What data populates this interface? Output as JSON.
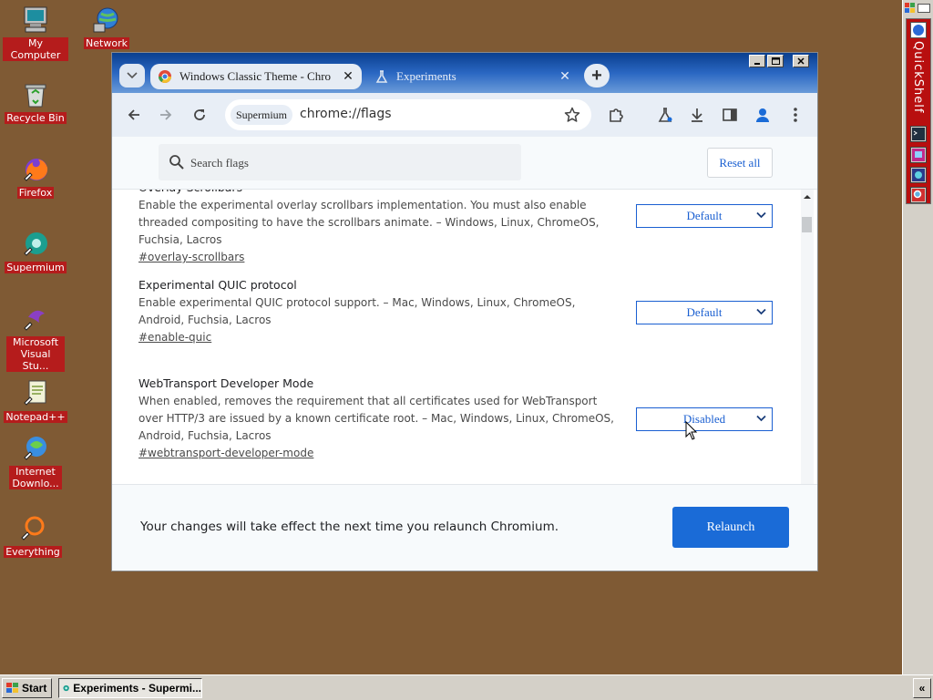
{
  "desktop": {
    "icons": [
      {
        "label": "My Computer",
        "icon": "my-computer-icon"
      },
      {
        "label": "Network",
        "icon": "network-icon"
      },
      {
        "label": "Recycle Bin",
        "icon": "recycle-bin-icon"
      },
      {
        "label": "Firefox",
        "icon": "firefox-icon"
      },
      {
        "label": "Supermium",
        "icon": "supermium-icon"
      },
      {
        "label": "Microsoft Visual Stu...",
        "icon": "visual-studio-icon"
      },
      {
        "label": "Notepad++",
        "icon": "notepad-plus-plus-icon"
      },
      {
        "label": "Internet Downlo...",
        "icon": "internet-download-manager-icon"
      },
      {
        "label": "Everything",
        "icon": "everything-search-icon"
      }
    ],
    "background_color": "#7f5a34"
  },
  "browser": {
    "tabs": [
      {
        "title": "Windows Classic Theme - Chro",
        "active": false
      },
      {
        "title": "Experiments",
        "active": true
      }
    ],
    "close_glyph": "✕",
    "new_tab_glyph": "+",
    "site_chip": "Supermium",
    "url": "chrome://flags"
  },
  "flags_page": {
    "search_placeholder": "Search flags",
    "reset_all_label": "Reset all",
    "flags": [
      {
        "name": "Overlay Scrollbars",
        "description": "Enable the experimental overlay scrollbars implementation. You must also enable threaded compositing to have the scrollbars animate. – Windows, Linux, ChromeOS, Fuchsia, Lacros",
        "link": "#overlay-scrollbars",
        "value": "Default"
      },
      {
        "name": "Experimental QUIC protocol",
        "description": "Enable experimental QUIC protocol support. – Mac, Windows, Linux, ChromeOS, Android, Fuchsia, Lacros",
        "link": "#enable-quic",
        "value": "Default"
      },
      {
        "name": "WebTransport Developer Mode",
        "description": "When enabled, removes the requirement that all certificates used for WebTransport over HTTP/3 are issued by a known certificate root. – Mac, Windows, Linux, ChromeOS, Android, Fuchsia, Lacros",
        "link": "#webtransport-developer-mode",
        "value": "Disabled"
      }
    ],
    "relaunch_message": "Your changes will take effect the next time you relaunch Chromium.",
    "relaunch_label": "Relaunch"
  },
  "quickshelf": {
    "title": "QuickShelf"
  },
  "taskbar": {
    "start_label": "Start",
    "task_label": "Experiments - Supermi...",
    "tray_glyph": "«"
  },
  "colors": {
    "accent_blue": "#1a6bd7",
    "desktop_label_bg": "#b51c1c",
    "title_bar": "#2a67c2"
  }
}
